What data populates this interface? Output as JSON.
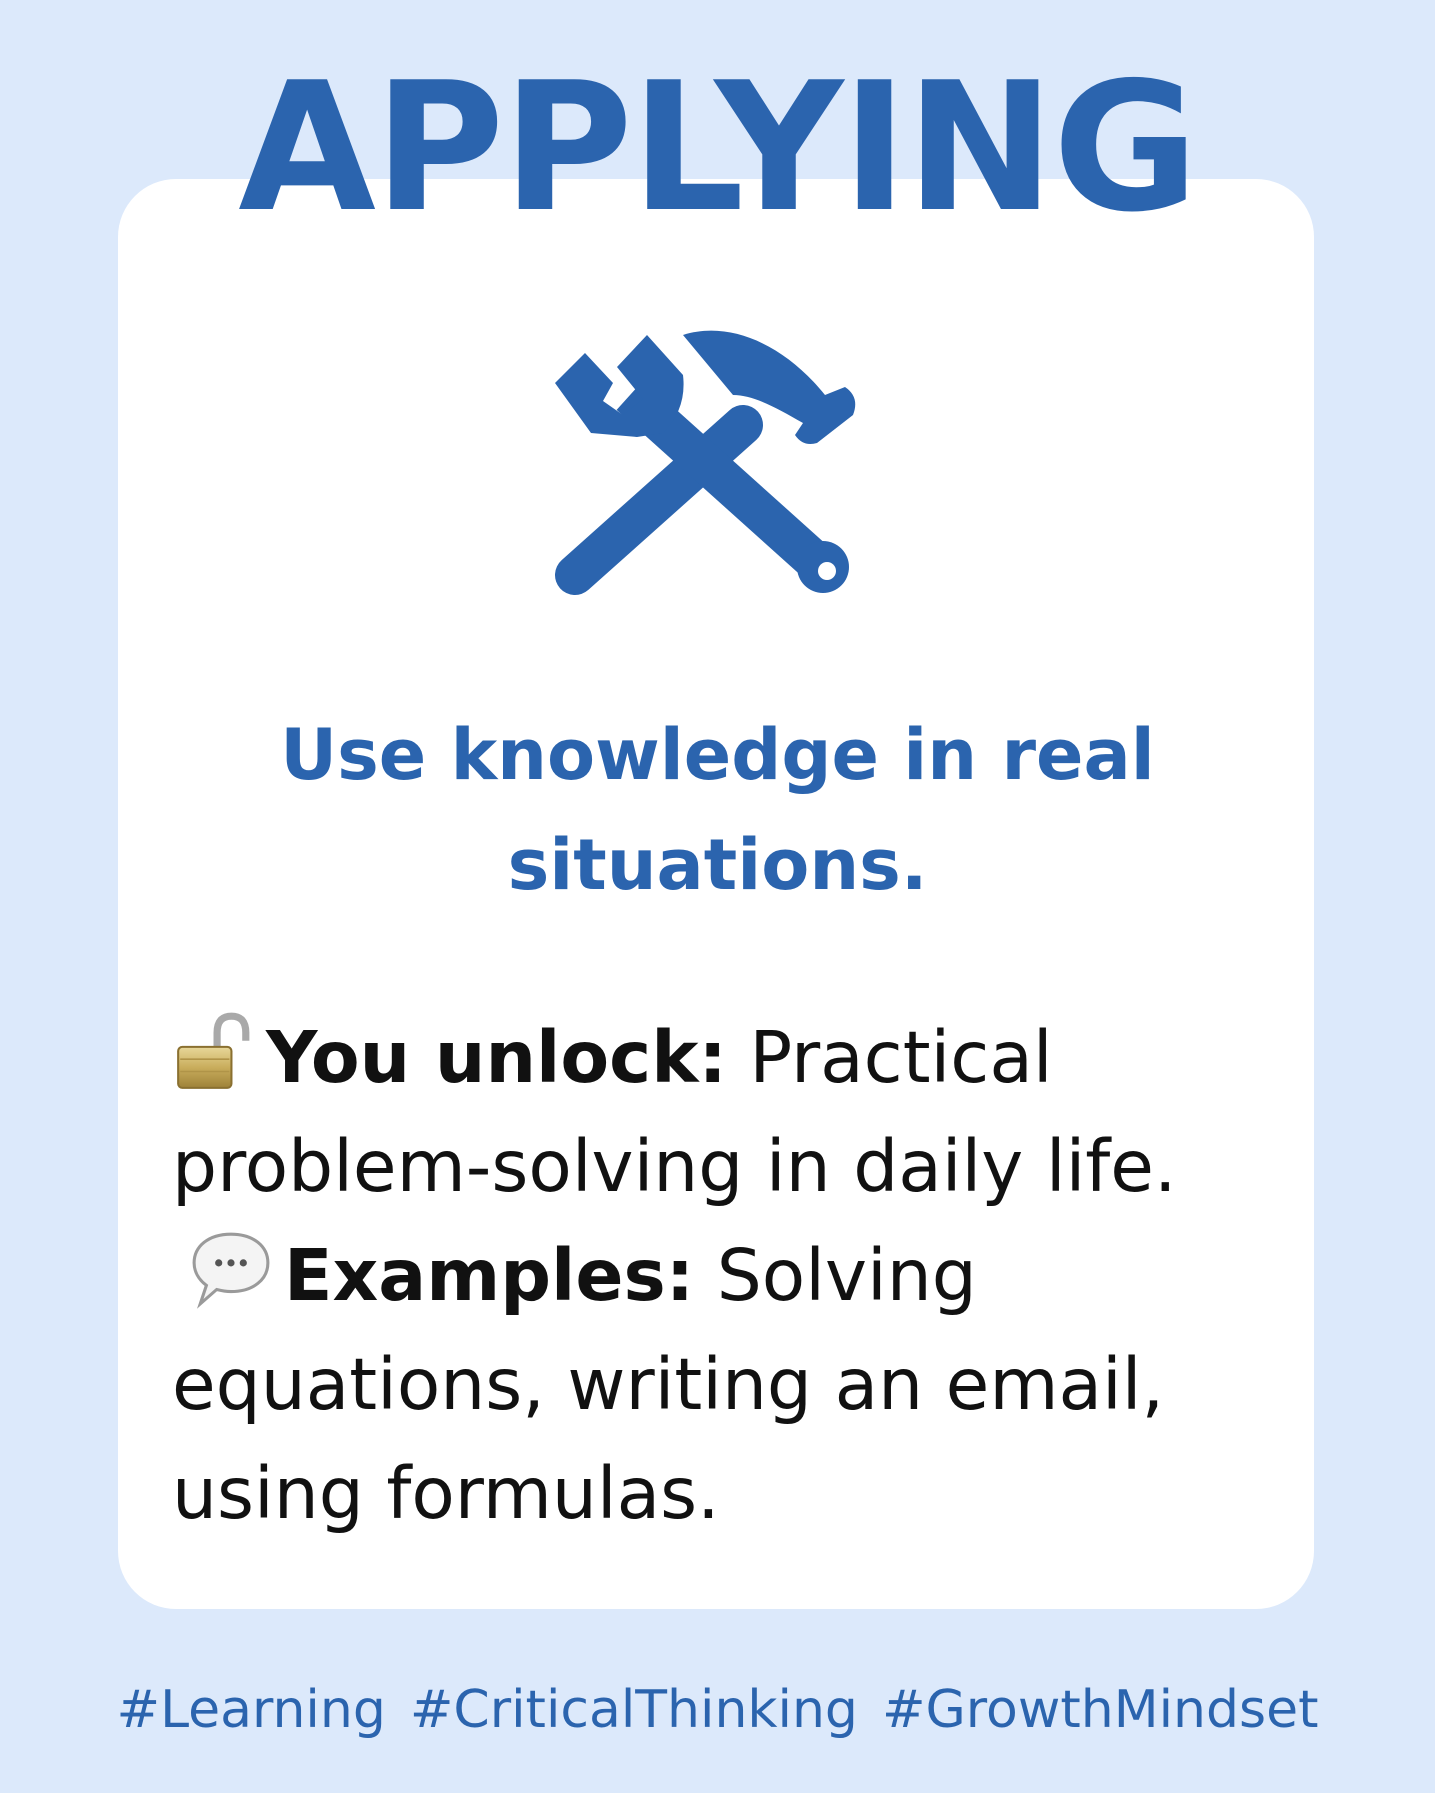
{
  "title": "APPLYING",
  "icon": "hammer-and-wrench-icon",
  "subtitle": "Use knowledge in real situations.",
  "unlock": {
    "icon": "open-lock-icon",
    "label": "You unlock:",
    "text": " Practical problem-solving in daily life."
  },
  "examples": {
    "icon": "speech-bubble-icon",
    "label": "Examples:",
    "text": " Solving equations, writing an email, using formulas."
  },
  "hashtags": [
    "#Learning",
    "#CriticalThinking",
    "#GrowthMindset"
  ],
  "colors": {
    "background": "#dce9fb",
    "card": "#ffffff",
    "accent": "#2b64ae",
    "text": "#111111"
  }
}
